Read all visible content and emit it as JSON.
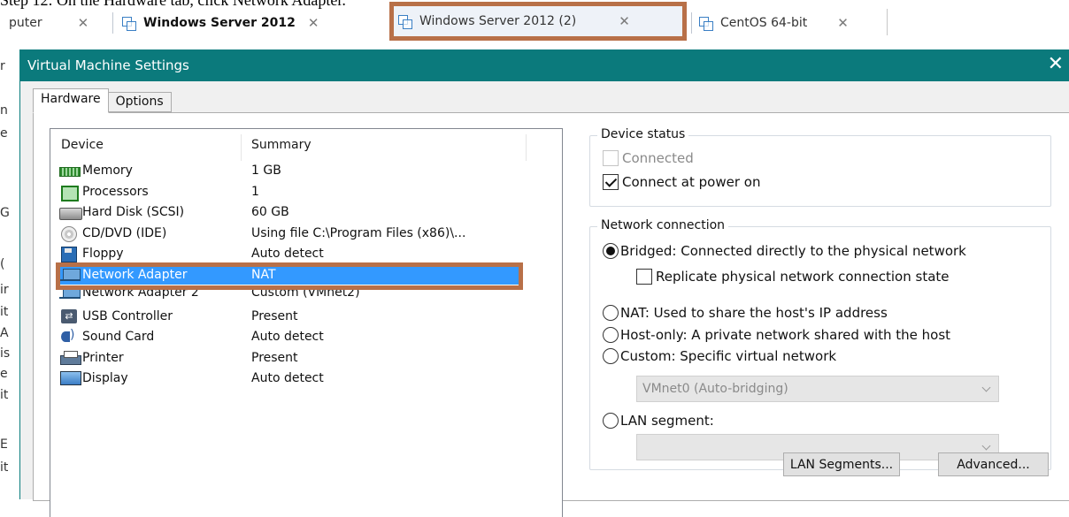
{
  "caption": "Step 12: On the Hardware tab, click Network Adapter.",
  "app_tabs": [
    {
      "label": "puter"
    },
    {
      "label": "Windows Server 2012"
    },
    {
      "label": "Windows Server 2012 (2)"
    },
    {
      "label": "CentOS 64-bit"
    }
  ],
  "tab_close_glyph": "✕",
  "background_letters": [
    "r",
    "n",
    "e",
    "G",
    "(",
    "ir",
    "it",
    "A",
    "is",
    "e",
    "it",
    "E",
    "it"
  ],
  "dialog": {
    "title": "Virtual Machine Settings",
    "close_glyph": "✕",
    "tabs": [
      {
        "label": "Hardware"
      },
      {
        "label": "Options"
      }
    ]
  },
  "device_list": {
    "headers": {
      "device": "Device",
      "summary": "Summary"
    },
    "rows": [
      {
        "device": "Memory",
        "summary": "1 GB",
        "icon": "memory-icon"
      },
      {
        "device": "Processors",
        "summary": "1",
        "icon": "processor-icon"
      },
      {
        "device": "Hard Disk (SCSI)",
        "summary": "60 GB",
        "icon": "hard-disk-icon"
      },
      {
        "device": "CD/DVD (IDE)",
        "summary": "Using file C:\\Program Files (x86)\\...",
        "icon": "cd-dvd-icon"
      },
      {
        "device": "Floppy",
        "summary": "Auto detect",
        "icon": "floppy-icon"
      },
      {
        "device": "Network Adapter",
        "summary": "NAT",
        "icon": "network-adapter-icon"
      },
      {
        "device": "Network Adapter 2",
        "summary": "Custom (VMnet2)",
        "icon": "network-adapter-icon"
      },
      {
        "device": "USB Controller",
        "summary": "Present",
        "icon": "usb-icon"
      },
      {
        "device": "Sound Card",
        "summary": "Auto detect",
        "icon": "sound-card-icon"
      },
      {
        "device": "Printer",
        "summary": "Present",
        "icon": "printer-icon"
      },
      {
        "device": "Display",
        "summary": "Auto detect",
        "icon": "display-icon"
      }
    ]
  },
  "device_status": {
    "title": "Device status",
    "connected": {
      "label": "Connected",
      "checked": false,
      "enabled": false
    },
    "connect_at_power_on": {
      "label": "Connect at power on",
      "checked": true
    }
  },
  "network_connection": {
    "title": "Network connection",
    "bridged": {
      "label": "Bridged: Connected directly to the physical network",
      "selected": true
    },
    "replicate": {
      "label": "Replicate physical network connection state",
      "checked": false
    },
    "nat": {
      "label": "NAT: Used to share the host's IP address",
      "selected": false
    },
    "host_only": {
      "label": "Host-only: A private network shared with the host",
      "selected": false
    },
    "custom": {
      "label": "Custom: Specific virtual network",
      "selected": false
    },
    "custom_select_value": "VMnet0 (Auto-bridging)",
    "lan_segment": {
      "label": "LAN segment:",
      "selected": false
    },
    "lan_select_value": ""
  },
  "buttons": {
    "lan_segments": "LAN Segments...",
    "advanced": "Advanced..."
  },
  "colors": {
    "titlebar": "#0b7a7c",
    "selection": "#3399ff",
    "highlight_frame": "#b87048"
  }
}
